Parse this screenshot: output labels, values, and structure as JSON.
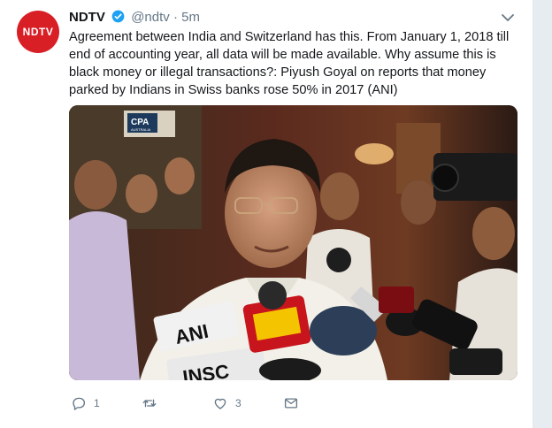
{
  "tweet": {
    "avatar_text": "NDTV",
    "name": "NDTV",
    "handle": "@ndtv",
    "separator": "·",
    "time": "5m",
    "text": "Agreement between India and Switzerland has this. From January 1, 2018 till end of accounting year, all data will be made available. Why assume this is black money or illegal transactions?: Piyush Goyal on reports that money parked by Indians in Swiss banks rose 50% in 2017 (ANI)",
    "media": {
      "banner_text": "CPA",
      "banner_sub": "AUSTRALIA",
      "mic_labels": [
        "ANI",
        "INSC"
      ]
    },
    "actions": {
      "reply_count": "1",
      "retweet_count": "",
      "like_count": "3"
    }
  },
  "colors": {
    "brand": "#d81f26",
    "verified": "#1da1f2",
    "muted": "#657786"
  },
  "icons": [
    "verified-badge-icon",
    "chevron-down-icon",
    "reply-icon",
    "retweet-icon",
    "like-icon",
    "direct-message-icon"
  ]
}
